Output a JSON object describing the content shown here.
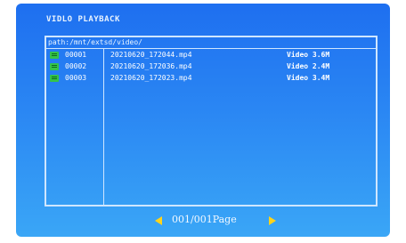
{
  "header": {
    "title": "VIDLO PLAYBACK"
  },
  "browser": {
    "path": "path:/mnt/extsd/video/",
    "rows": [
      {
        "index": "00001",
        "name": "20210620_172044.mp4",
        "info": "Video 3.6M"
      },
      {
        "index": "00002",
        "name": "20210620_172036.mp4",
        "info": "Video 2.4M"
      },
      {
        "index": "00003",
        "name": "20210620_172023.mp4",
        "info": "Video 3.4M"
      }
    ]
  },
  "pager": {
    "label": "001/001Page"
  },
  "colors": {
    "accent": "#ffd31a",
    "folder": "#35c34a",
    "border": "#cfe6ff"
  },
  "icons": {
    "row": "folder-icon",
    "prev": "triangle-left-icon",
    "next": "triangle-right-icon"
  }
}
